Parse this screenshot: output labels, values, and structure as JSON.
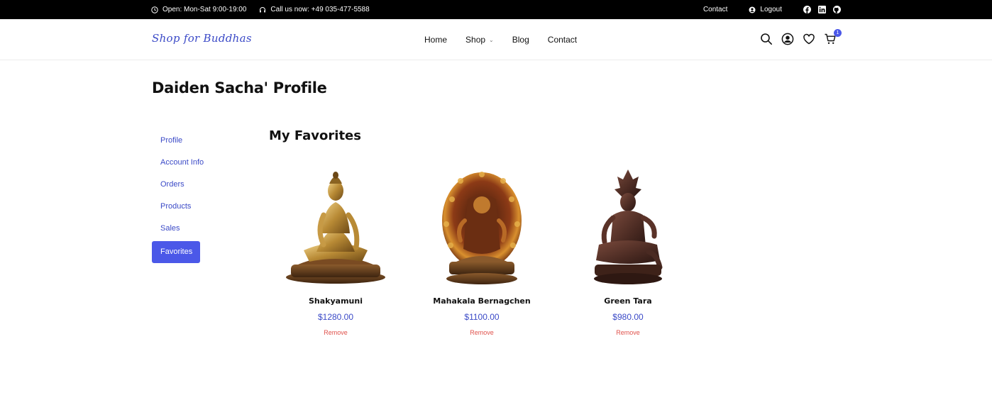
{
  "topbar": {
    "hours": "Open: Mon-Sat 9:00-19:00",
    "phone": "Call us now: +49 035-477-5588",
    "contact": "Contact",
    "logout": "Logout",
    "icons": [
      "clock-icon",
      "headset-icon",
      "user-circle-icon",
      "facebook-icon",
      "linkedin-icon",
      "github-icon"
    ]
  },
  "header": {
    "logo": "Shop for Buddhas",
    "nav": [
      "Home",
      "Shop",
      "Blog",
      "Contact"
    ],
    "cart_count": "1",
    "icons": [
      "search-icon",
      "account-icon",
      "heart-icon",
      "cart-icon"
    ]
  },
  "page": {
    "title": "Daiden Sacha' Profile",
    "section_title": "My Favorites"
  },
  "sidebar": {
    "items": [
      {
        "label": "Profile"
      },
      {
        "label": "Account Info"
      },
      {
        "label": "Orders"
      },
      {
        "label": "Products"
      },
      {
        "label": "Sales"
      },
      {
        "label": "Favorites"
      }
    ],
    "active": "Favorites"
  },
  "favorites": [
    {
      "name": "Shakyamuni",
      "price": "$1280.00",
      "action": "Remove"
    },
    {
      "name": "Mahakala Bernagchen",
      "price": "$1100.00",
      "action": "Remove"
    },
    {
      "name": "Green Tara",
      "price": "$980.00",
      "action": "Remove"
    }
  ],
  "colors": {
    "accent": "#4b58e8",
    "link": "#3b4ac7",
    "remove": "#e0524c",
    "topbar": "#000000"
  }
}
